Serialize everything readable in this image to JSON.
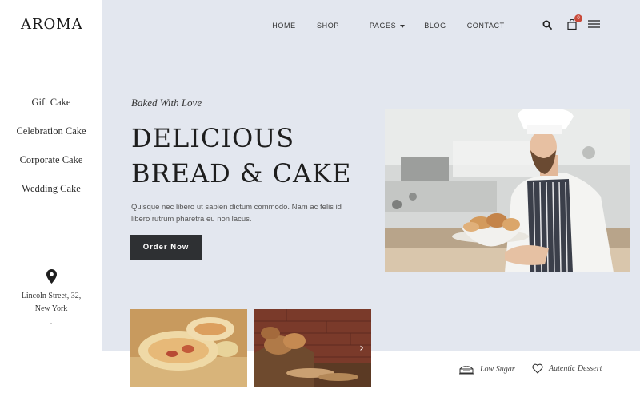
{
  "brand": {
    "logo": "AROMA"
  },
  "sidebar": {
    "categories": [
      {
        "label": "Gift Cake"
      },
      {
        "label": "Celebration Cake"
      },
      {
        "label": "Corporate Cake"
      },
      {
        "label": "Wedding Cake"
      }
    ],
    "address_line1": "Lincoln Street, 32,",
    "address_line2": "New York"
  },
  "nav": {
    "items": [
      {
        "label": "HOME",
        "active": true
      },
      {
        "label": "SHOP"
      },
      {
        "label": "PAGES"
      },
      {
        "label": "BLOG"
      },
      {
        "label": "CONTACT"
      }
    ],
    "cart_count": "0"
  },
  "hero": {
    "kicker": "Baked With Love",
    "headline_line1": "DELICIOUS",
    "headline_line2": "BREAD & CAKE",
    "lead": "Quisque nec libero ut sapien dictum commodo. Nam ac felis id libero rutrum pharetra eu non lacus.",
    "cta": "Order Now"
  },
  "features": [
    {
      "label": "Low Sugar",
      "icon": "cake-icon"
    },
    {
      "label": "Autentic Dessert",
      "icon": "heart-icon"
    }
  ],
  "colors": {
    "hero_bg": "#e3e7ef",
    "button_bg": "#2e3033",
    "badge": "#c84a3a"
  }
}
